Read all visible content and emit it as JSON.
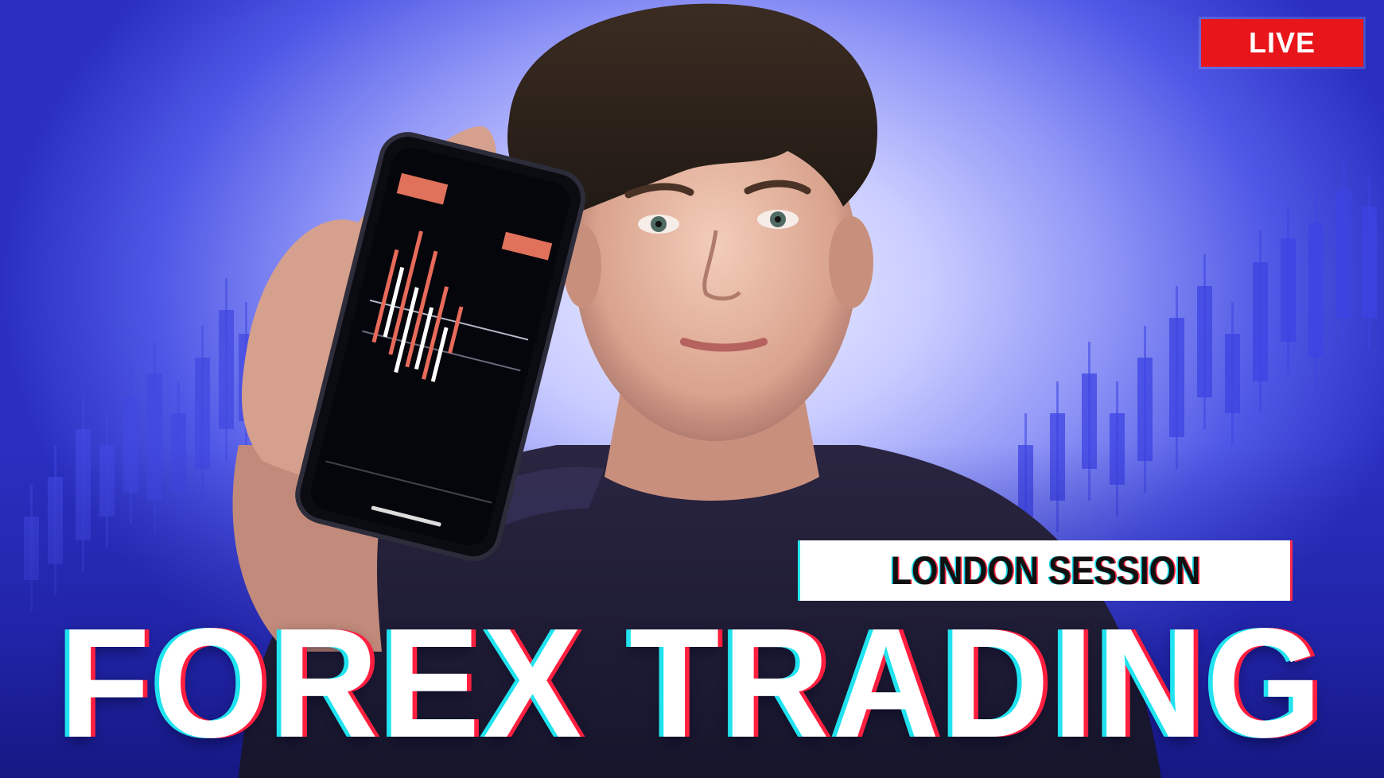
{
  "badge": {
    "label": "LIVE",
    "color": "#e8151b"
  },
  "session": {
    "label": "LONDON SESSION"
  },
  "title": {
    "text": "FOREX TRADING"
  },
  "colors": {
    "background_accent": "#4f58e6",
    "glitch_cyan": "#21e3ef",
    "glitch_red": "#ff1f3f"
  },
  "scene": {
    "subject": "person-holding-phone",
    "phone_screen": "candlestick-trading-chart",
    "background": "candlestick-chart-pattern"
  }
}
